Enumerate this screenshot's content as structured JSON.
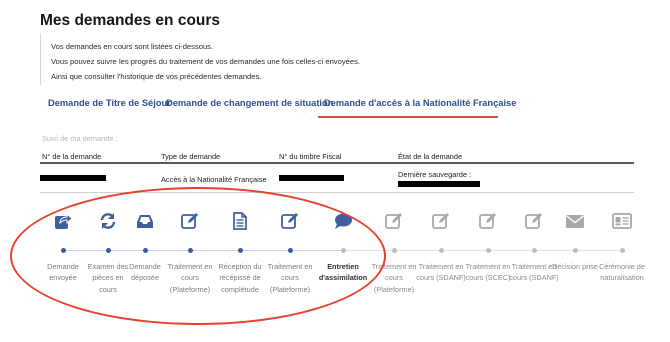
{
  "page_title": "Mes demandes en cours",
  "intro": [
    "Vos demandes en cours sont listées ci-dessous.",
    "Vous pouvez suivre les progrès du traitement de vos demandes une fois celles-ci envoyées.",
    "Ainsi que consulter l'historique de vos précédentes demandes."
  ],
  "tabs": [
    {
      "label": "Demande de Titre de Séjour",
      "active": false
    },
    {
      "label": "Demande de changement de situation",
      "active": false
    },
    {
      "label": "Demande d'accès à la Nationalité Française",
      "active": true
    }
  ],
  "tracking": {
    "section_label": "Suivi de ma demande :",
    "columns": [
      "N° de la demande",
      "Type de demande",
      "N° du timbre Fiscal",
      "État de la demande"
    ],
    "row": {
      "request_type": "Accès à la Nationalité Française",
      "state_label": "Dernière sauvegarde :"
    }
  },
  "steps": [
    {
      "label": "Demande envoyée",
      "icon": "share-arrow-icon",
      "status": "done"
    },
    {
      "label": "Examen des pièces en cours",
      "icon": "refresh-icon",
      "status": "done"
    },
    {
      "label": "Demande déposée",
      "icon": "inbox-icon",
      "status": "done"
    },
    {
      "label": "Traitement en cours (Plateforme)",
      "icon": "edit-icon",
      "status": "done"
    },
    {
      "label": "Réception du récépissé de complétude",
      "icon": "document-icon",
      "status": "done"
    },
    {
      "label": "Traitement en cours (Plateforme)",
      "icon": "edit-icon",
      "status": "done"
    },
    {
      "label": "Entretien d'assimilation",
      "icon": "chat-bubble-icon",
      "status": "current"
    },
    {
      "label": "Traitement en cours (Plateforme)",
      "icon": "edit-icon",
      "status": "pending"
    },
    {
      "label": "Traitement en cours (SDANF)",
      "icon": "edit-icon",
      "status": "pending"
    },
    {
      "label": "Traitement en cours (SCEC)",
      "icon": "edit-icon",
      "status": "pending"
    },
    {
      "label": "Traitement en cours (SDANF)",
      "icon": "edit-icon",
      "status": "pending"
    },
    {
      "label": "Décision prise",
      "icon": "envelope-icon",
      "status": "pending"
    },
    {
      "label": "Cérémonie de naturalisation",
      "icon": "id-card-icon",
      "status": "pending"
    }
  ],
  "colors": {
    "accent_blue": "#2f4f8e",
    "done_icon": "#3f5f9f",
    "pending_icon": "#a8a8a8",
    "tab_underline": "#d9533a",
    "annotation_red": "#e8402c"
  }
}
